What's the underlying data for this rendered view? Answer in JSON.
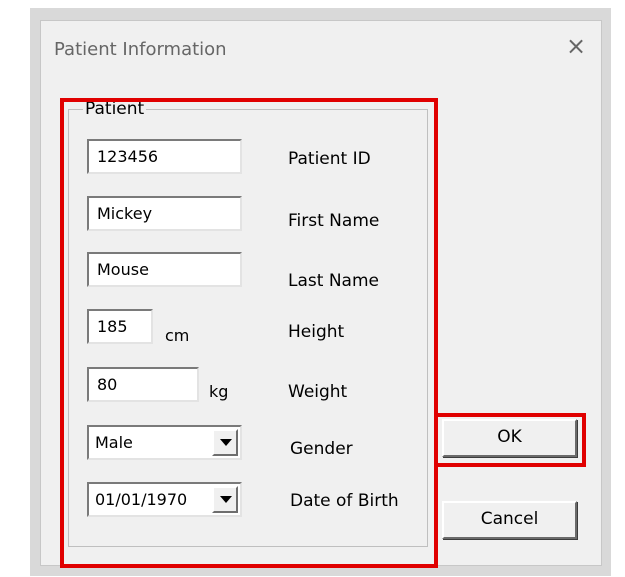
{
  "dialog": {
    "title": "Patient Information",
    "close_glyph": "×"
  },
  "group": {
    "label": "Patient"
  },
  "fields": {
    "patient_id": {
      "value": "123456",
      "label": "Patient ID"
    },
    "first_name": {
      "value": "Mickey",
      "label": "First Name"
    },
    "last_name": {
      "value": "Mouse",
      "label": "Last Name"
    },
    "height": {
      "value": "185",
      "unit": "cm",
      "label": "Height"
    },
    "weight": {
      "value": "80",
      "unit": "kg",
      "label": "Weight"
    },
    "gender": {
      "value": "Male",
      "label": "Gender"
    },
    "date_of_birth": {
      "value": "01/01/1970",
      "label": "Date of Birth"
    }
  },
  "buttons": {
    "ok_label": "OK",
    "cancel_label": "Cancel"
  },
  "highlight_color": "#e00000"
}
